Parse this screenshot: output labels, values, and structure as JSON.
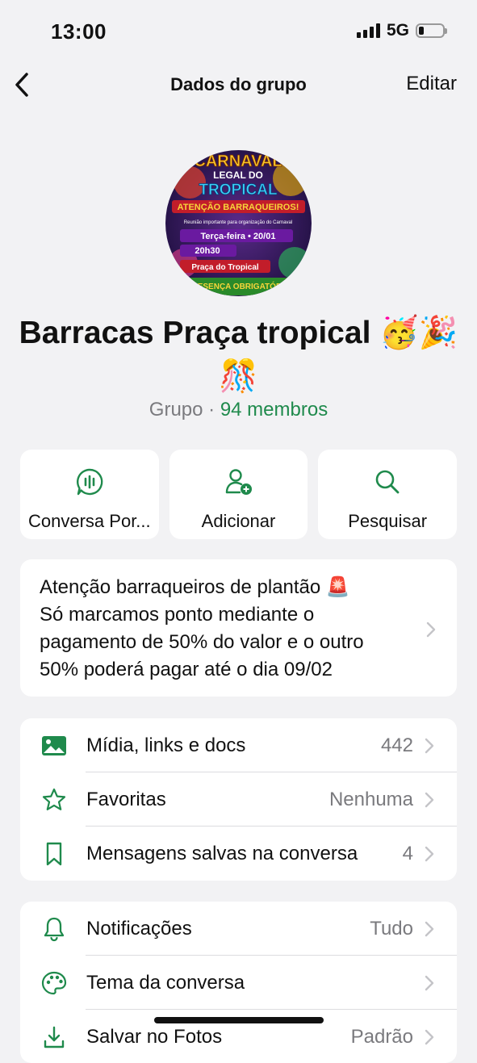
{
  "status": {
    "time": "13:00",
    "network": "5G",
    "battery_level": 0.2
  },
  "nav": {
    "title": "Dados do grupo",
    "edit_label": "Editar"
  },
  "group": {
    "avatar_icon": "carnival-poster-image",
    "avatar_text": [
      "CARNAVAL",
      "LEGAL DO",
      "TROPICAL",
      "ATENÇÃO BARRAQUEIROS!",
      "Reunião importante para organização do Carnaval",
      "Terça-feira • 20/01",
      "20h30",
      "Praça do Tropical",
      "PRESENÇA OBRIGATÓRIA"
    ],
    "name": "Barracas Praça tropical 🥳🎉🎊",
    "type_label": "Grupo",
    "separator": " · ",
    "members_label": "94 membros"
  },
  "actions": [
    {
      "icon": "voice-chat-icon",
      "label": "Conversa Por..."
    },
    {
      "icon": "add-person-icon",
      "label": "Adicionar"
    },
    {
      "icon": "search-icon",
      "label": "Pesquisar"
    }
  ],
  "description": {
    "lines": [
      "Atenção barraqueiros de plantão 🚨",
      "Só marcamos ponto mediante o",
      "pagamento de 50% do valor e o outro",
      "50% poderá pagar até o dia 09/02"
    ]
  },
  "media_section": [
    {
      "icon": "photo-icon",
      "label": "Mídia, links e docs",
      "value": "442"
    },
    {
      "icon": "star-icon",
      "label": "Favoritas",
      "value": "Nenhuma"
    },
    {
      "icon": "bookmark-icon",
      "label": "Mensagens salvas na conversa",
      "value": "4"
    }
  ],
  "settings_section": [
    {
      "icon": "bell-icon",
      "label": "Notificações",
      "value": "Tudo"
    },
    {
      "icon": "palette-icon",
      "label": "Tema da conversa",
      "value": ""
    },
    {
      "icon": "download-icon",
      "label": "Salvar no Fotos",
      "value": "Padrão"
    }
  ],
  "colors": {
    "accent": "#1f8a4c",
    "background": "#f2f2f4",
    "card": "#ffffff",
    "secondary_text": "#7a7a7e"
  }
}
